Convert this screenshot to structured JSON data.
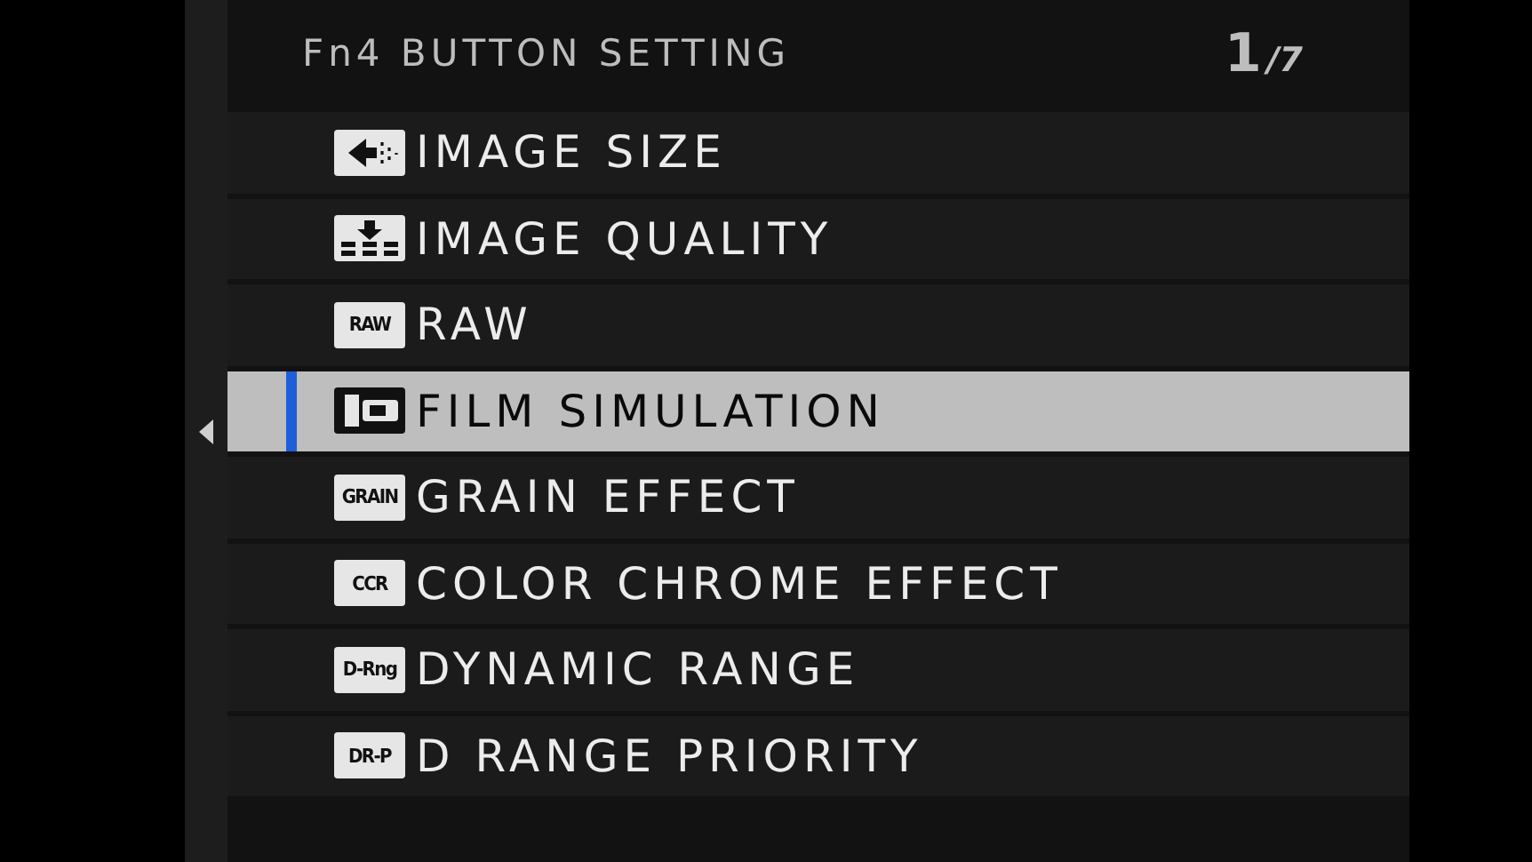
{
  "header": {
    "title": "Fn4 BUTTON SETTING",
    "page": "1",
    "total": "/7"
  },
  "items": [
    {
      "label": "IMAGE SIZE",
      "kind": "arrow-glyph",
      "selected": false
    },
    {
      "label": "IMAGE QUALITY",
      "kind": "stack-glyph",
      "selected": false
    },
    {
      "label": "RAW",
      "kind": "badge",
      "badge": "RAW",
      "selected": false
    },
    {
      "label": "FILM SIMULATION",
      "kind": "film-glyph",
      "selected": true
    },
    {
      "label": "GRAIN EFFECT",
      "kind": "badge",
      "badge": "GRAIN",
      "selected": false
    },
    {
      "label": "COLOR CHROME EFFECT",
      "kind": "badge",
      "badge": "CCR",
      "selected": false
    },
    {
      "label": "DYNAMIC RANGE",
      "kind": "badge",
      "badge": "D-Rng",
      "selected": false
    },
    {
      "label": "D RANGE PRIORITY",
      "kind": "badge",
      "badge": "DR-P",
      "selected": false
    }
  ]
}
